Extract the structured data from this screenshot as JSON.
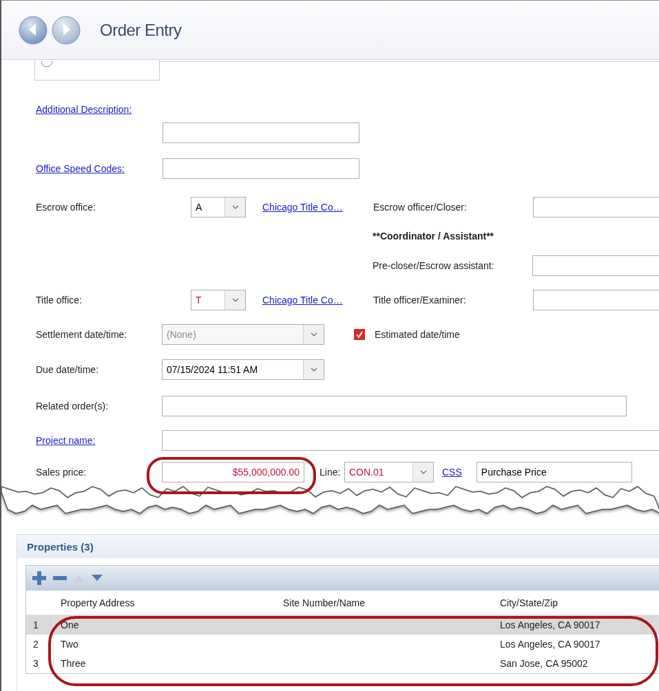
{
  "window": {
    "title": "Order Entry"
  },
  "form": {
    "other_radio": {
      "selected": false
    },
    "additional_description": {
      "label": "Additional Description:",
      "kind": "link"
    },
    "office_speed_codes": {
      "label": "Office Speed Codes:",
      "kind": "link"
    },
    "escrow_office": {
      "label": "Escrow office:",
      "kind": "text",
      "code": "A",
      "required": false,
      "link": "Chicago Title Co…"
    },
    "escrow_officer": {
      "label": "Escrow officer/Closer:",
      "kind": "text"
    },
    "coordinator_heading": "**Coordinator / Assistant**",
    "pre_closer": {
      "label": "Pre-closer/Escrow assistant:",
      "kind": "text"
    },
    "title_office": {
      "label": "Title office:",
      "kind": "text",
      "code": "T",
      "required": true,
      "link": "Chicago Title Co…"
    },
    "title_officer": {
      "label": "Title officer/Examiner:",
      "kind": "text"
    },
    "settlement": {
      "label": "Settlement date/time:",
      "kind": "text",
      "value": "(None)",
      "disabled": true
    },
    "estimated": {
      "label": "Estimated date/time",
      "checked": true
    },
    "due": {
      "label": "Due date/time:",
      "kind": "text",
      "value": "07/15/2024 11:51 AM",
      "disabled": false
    },
    "related_orders": {
      "label": "Related order(s):",
      "kind": "text"
    },
    "project_name": {
      "label": "Project name:",
      "kind": "link"
    },
    "sales_price": {
      "label": "Sales price:",
      "kind": "text",
      "value": "$55,000,000.00",
      "required": true
    },
    "line": {
      "label": "Line:",
      "code": "CON.01",
      "required": true,
      "link": "CSS",
      "description": "Purchase Price"
    }
  },
  "properties": {
    "title": "Properties (3)",
    "toolbar": [
      {
        "kind": "add",
        "disabled": false
      },
      {
        "kind": "remove",
        "disabled": false
      },
      {
        "kind": "move_up",
        "disabled": true
      },
      {
        "kind": "move_down",
        "disabled": false
      }
    ],
    "columns": [
      "Property Address",
      "Site Number/Name",
      "City/State/Zip"
    ],
    "rows": [
      {
        "number": "1",
        "address": "One",
        "city": "Los Angeles, CA 90017",
        "selected": true
      },
      {
        "number": "2",
        "address": "Two",
        "city": "Los Angeles, CA 90017",
        "selected": false
      },
      {
        "number": "3",
        "address": "Three",
        "city": "San Jose, CA 95002",
        "selected": false
      }
    ]
  }
}
